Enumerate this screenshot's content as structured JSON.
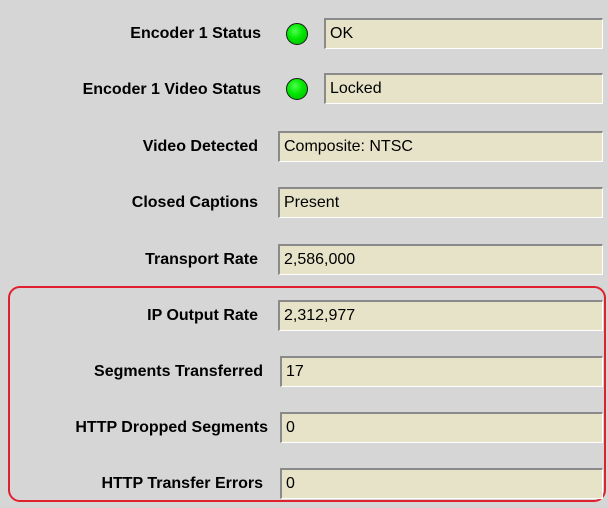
{
  "status_panel": {
    "encoder_status": {
      "label": "Encoder 1 Status",
      "indicator_color": "#00e600",
      "value": "OK"
    },
    "encoder_video_status": {
      "label": "Encoder 1 Video Status",
      "indicator_color": "#00e600",
      "value": "Locked"
    },
    "video_detected": {
      "label": "Video Detected",
      "value": "Composite: NTSC"
    },
    "closed_captions": {
      "label": "Closed Captions",
      "value": "Present"
    },
    "transport_rate": {
      "label": "Transport Rate",
      "value": "2,586,000"
    }
  },
  "output_panel": {
    "highlight_color": "#e0202e",
    "ip_output_rate": {
      "label": "IP Output Rate",
      "value": "2,312,977"
    },
    "segments_transferred": {
      "label": "Segments Transferred",
      "value": "17"
    },
    "http_dropped_segments": {
      "label": "HTTP Dropped Segments",
      "value": "0"
    },
    "http_transfer_errors": {
      "label": "HTTP Transfer Errors",
      "value": "0"
    }
  }
}
